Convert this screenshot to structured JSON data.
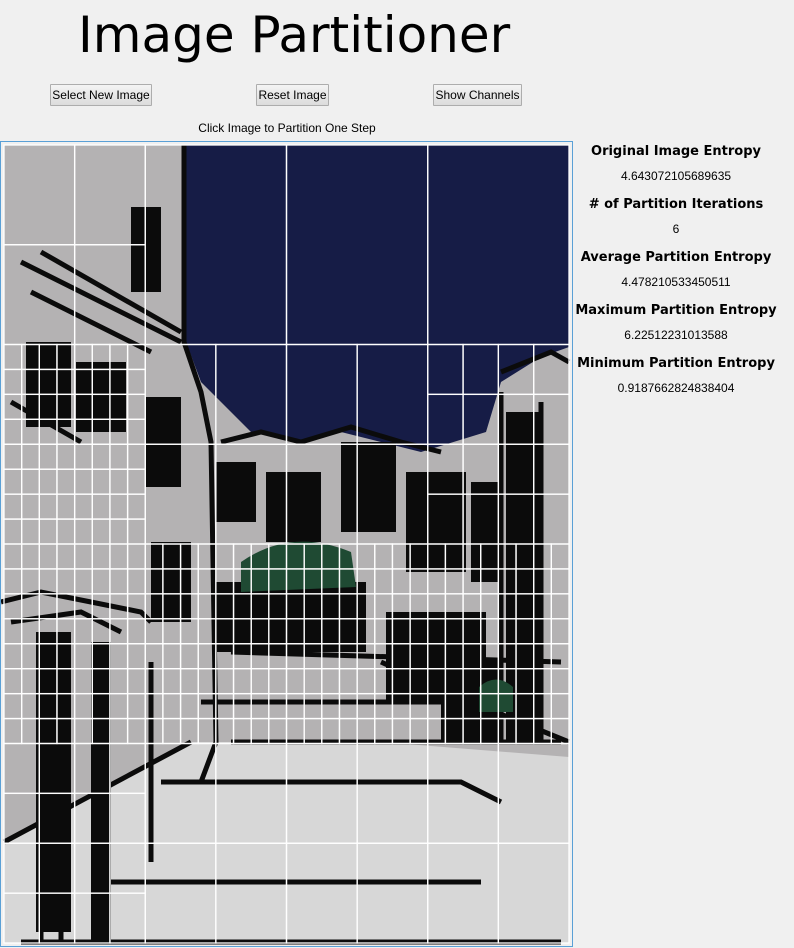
{
  "app": {
    "title": "Image Partitioner"
  },
  "toolbar": {
    "select_label": "Select New Image",
    "reset_label": "Reset Image",
    "channels_label": "Show Channels"
  },
  "canvas": {
    "instruction": "Click Image to Partition One Step",
    "colors": {
      "sky": "#161c46",
      "wall": "#b4b2b3",
      "street": "#d7d7d7",
      "ink": "#0b0b0b",
      "tree": "#1f4a33",
      "grid": "#ffffff"
    }
  },
  "stats": {
    "original_entropy_label": "Original Image Entropy",
    "original_entropy_value": "4.643072105689635",
    "iterations_label": "# of Partition Iterations",
    "iterations_value": "6",
    "average_entropy_label": "Average Partition Entropy",
    "average_entropy_value": "4.478210533450511",
    "max_entropy_label": "Maximum Partition Entropy",
    "max_entropy_value": "6.22512231013588",
    "min_entropy_label": "Minimum Partition Entropy",
    "min_entropy_value": "0.9187662824838404"
  }
}
